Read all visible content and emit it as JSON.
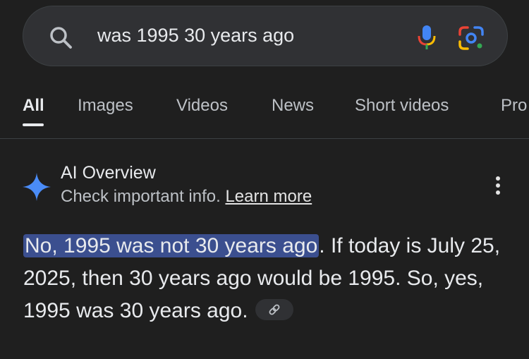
{
  "search": {
    "query": "was 1995 30 years ago"
  },
  "tabs": [
    {
      "label": "All",
      "active": true
    },
    {
      "label": "Images",
      "active": false
    },
    {
      "label": "Videos",
      "active": false
    },
    {
      "label": "News",
      "active": false
    },
    {
      "label": "Short videos",
      "active": false
    },
    {
      "label": "Pro",
      "active": false
    }
  ],
  "ai_overview": {
    "title": "AI Overview",
    "subtitle_text": "Check important info.",
    "learn_more": "Learn more",
    "answer_highlight": "No, 1995 was not 30 years ago",
    "answer_rest": ". If today is July 25, 2025, then 30 years ago would be 1995. So, yes, 1995 was 30 years ago."
  },
  "icons": {
    "search": "search-icon",
    "mic": "mic-icon",
    "lens": "google-lens-icon",
    "sparkle": "ai-sparkle-icon",
    "more": "more-vert-icon",
    "link": "link-icon"
  },
  "colors": {
    "background": "#1f1f1f",
    "search_bar": "#303134",
    "highlight": "#3b4f8f",
    "sparkle": "#4a8cf7"
  }
}
